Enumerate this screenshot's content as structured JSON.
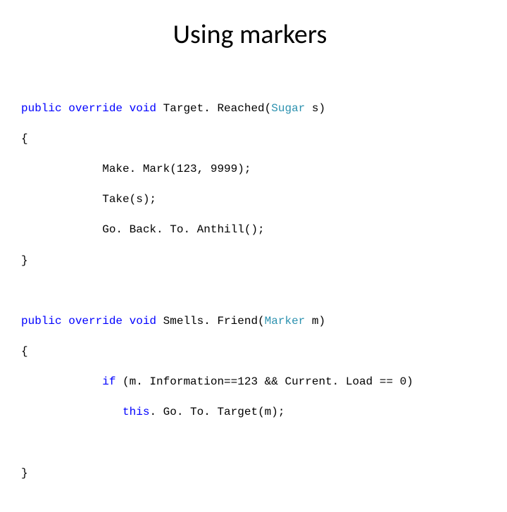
{
  "title": "Using markers",
  "code": {
    "m1": {
      "sig_kw": "public override void",
      "sig_name": " Target. Reached(",
      "sig_type": "Sugar",
      "sig_tail": " s)",
      "open": "{",
      "b1": "            Make. Mark(123, 9999);",
      "b2": "            Take(s);",
      "b3": "            Go. Back. To. Anthill();",
      "close": "}"
    },
    "m2": {
      "sig_kw": "public override void",
      "sig_name": " Smells. Friend(",
      "sig_type": "Marker",
      "sig_tail": " m)",
      "open": "{",
      "b1_pre": "            ",
      "b1_kw": "if",
      "b1_post": " (m. Information==123 && Current. Load == 0)",
      "b2_pre": "               ",
      "b2_kw": "this",
      "b2_post": ". Go. To. Target(m);",
      "close": "}"
    }
  }
}
